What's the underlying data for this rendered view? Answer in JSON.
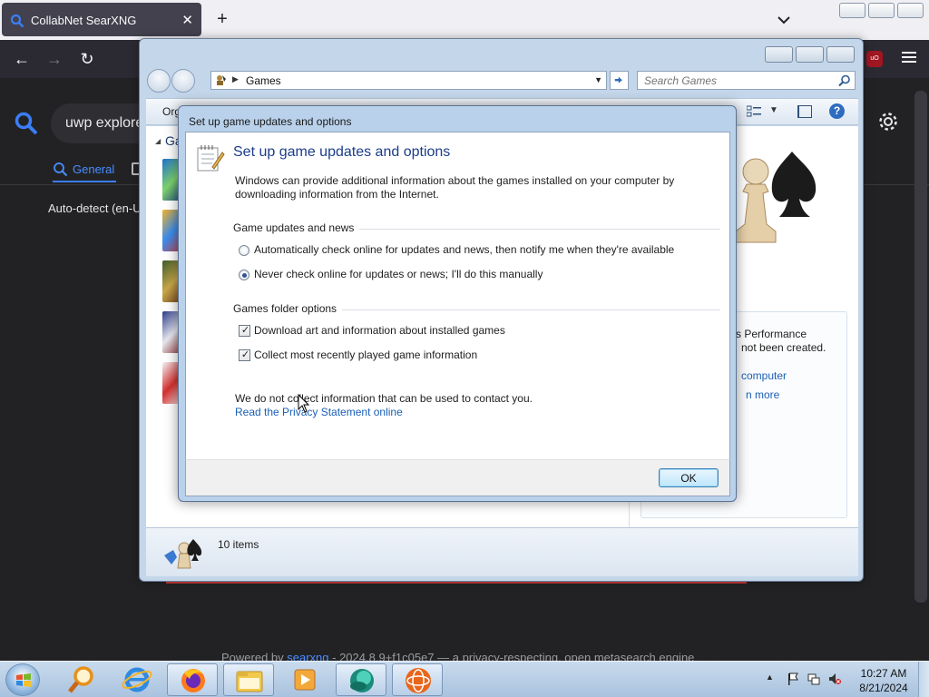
{
  "browser": {
    "tab_title": "CollabNet SearXNG",
    "tab_close": "✕",
    "new_tab": "+",
    "back": "←",
    "forward": "→",
    "reload": "↻",
    "ublock": "uO"
  },
  "searxng": {
    "query": "uwp explore",
    "category_general": "General",
    "autodetect": "Auto-detect (en-U",
    "footer_powered": "Powered by ",
    "footer_link": "searxng",
    "footer_rest": " - 2024.8.9+f1c05e7 — a privacy-respecting, open metasearch engine"
  },
  "explorer": {
    "address": "Games",
    "search_placeholder": "Search Games",
    "organize": "Org",
    "tree_label": "Ga",
    "perf_text_1": "s Performance",
    "perf_text_2": "not been created.",
    "perf_link_1": "computer",
    "perf_link_2": "n more",
    "status": "10 items"
  },
  "dialog": {
    "window_title": "Set up game updates and options",
    "heading": "Set up game updates and options",
    "intro": "Windows can provide additional information about the games installed on your computer by downloading information from the Internet.",
    "group_updates": "Game updates and news",
    "radio_auto": "Automatically check online for updates and news, then notify me when they're available",
    "radio_never": "Never check online for updates or news; I'll do this manually",
    "group_folder": "Games folder options",
    "check_art": "Download art and information about installed games",
    "check_recent": "Collect most recently played game information",
    "privacy_note": "We do not collect information that can be used to contact you.",
    "privacy_link": "Read the Privacy Statement online",
    "ok": "OK"
  },
  "taskbar": {
    "time": "10:27 AM",
    "date": "8/21/2024"
  },
  "colors": {
    "accent_blue": "#1c3d8a",
    "link_blue": "#1a5fb4",
    "searx_blue": "#3b7ef5"
  },
  "icons": [
    "searxng-icon",
    "search-icon",
    "gear-icon",
    "chevron-down-icon",
    "games-folder-icon",
    "refresh-icon",
    "help-icon",
    "chess-icon",
    "notepad-icon",
    "windows-start-icon",
    "firefox-icon",
    "ie-icon",
    "explorer-icon",
    "media-player-icon",
    "network-icon",
    "flag-icon",
    "speaker-muted-icon"
  ]
}
